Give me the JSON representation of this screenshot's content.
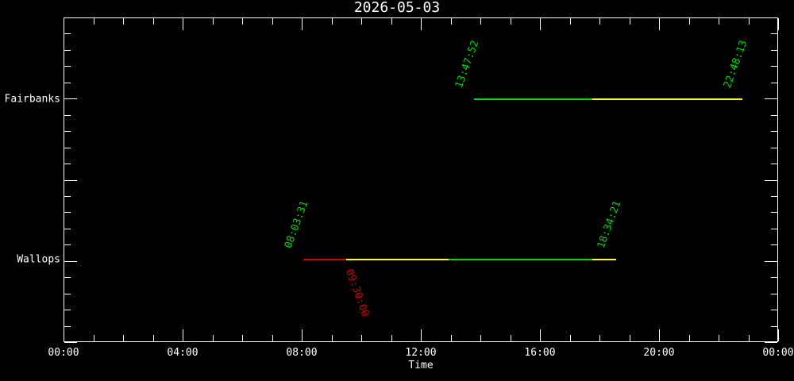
{
  "chart_data": {
    "type": "timeline",
    "title": "2026-05-03",
    "xlabel": "Time",
    "x_axis_hours": [
      0,
      24
    ],
    "x_tick_step_hours": 1,
    "x_major_step_hours": 4,
    "x_ticks_major": [
      "00:00",
      "04:00",
      "08:00",
      "12:00",
      "16:00",
      "20:00",
      "00:00"
    ],
    "grid": "off",
    "background": "#000000",
    "colors": {
      "green": "#00dd00",
      "yellow": "#ffff00",
      "red": "#dd0000",
      "axis": "#ffffff"
    },
    "stations": [
      "Fairbanks",
      "Wallops"
    ],
    "rows": [
      {
        "label": "Fairbanks",
        "y_frac": 0.252,
        "segments": [
          {
            "start": "13:47:52",
            "end": "17:45:36",
            "color": "green"
          },
          {
            "start": "17:45:36",
            "end": "22:48:13",
            "color": "yellow"
          }
        ],
        "annotations": [
          {
            "text": "13:47:52",
            "time": "13:47:52",
            "color": "green",
            "side": "above"
          },
          {
            "text": "22:48:13",
            "time": "22:48:13",
            "color": "green",
            "side": "above"
          }
        ]
      },
      {
        "label": "Wallops",
        "y_frac": 0.746,
        "segments": [
          {
            "start": "08:03:31",
            "end": "09:30:00",
            "color": "red"
          },
          {
            "start": "09:30:00",
            "end": "12:56:00",
            "color": "yellow"
          },
          {
            "start": "12:56:00",
            "end": "17:45:36",
            "color": "green"
          },
          {
            "start": "17:45:36",
            "end": "18:34:21",
            "color": "yellow"
          }
        ],
        "annotations": [
          {
            "text": "08:03:31",
            "time": "08:03:31",
            "color": "green",
            "side": "above"
          },
          {
            "text": "18:34:21",
            "time": "18:34:21",
            "color": "green",
            "side": "above"
          },
          {
            "text": "09:30:00",
            "time": "09:30:00",
            "color": "red",
            "side": "below"
          }
        ]
      }
    ]
  }
}
